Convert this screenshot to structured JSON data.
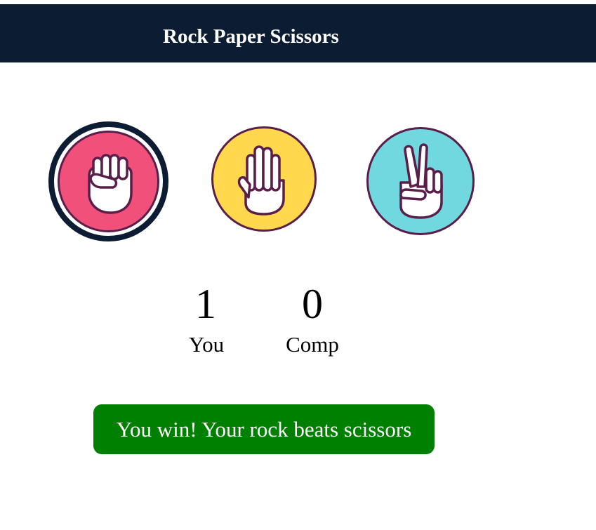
{
  "header": {
    "title": "Rock Paper Scissors"
  },
  "choices": [
    {
      "name": "rock",
      "icon": "rock-hand-icon",
      "color": "#f0507a",
      "selected": true
    },
    {
      "name": "paper",
      "icon": "paper-hand-icon",
      "color": "#ffd84d",
      "selected": false
    },
    {
      "name": "scissors",
      "icon": "scissors-hand-icon",
      "color": "#72d8e0",
      "selected": false
    }
  ],
  "scoreboard": {
    "user_score": "1",
    "user_label": "You",
    "comp_score": "0",
    "comp_label": "Comp"
  },
  "result": {
    "message": "You win! Your rock beats scissors",
    "color": "#008000"
  },
  "colors": {
    "header_bg": "#0c1c33",
    "selected_ring": "#0c1c33",
    "icon_outline": "#5a1e4a"
  }
}
